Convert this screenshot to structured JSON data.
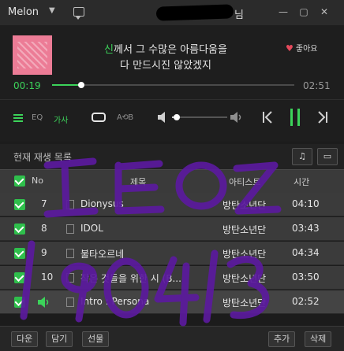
{
  "app": {
    "name": "Melon",
    "username_suffix": "님"
  },
  "window_controls": [
    "—",
    "▢",
    "✕"
  ],
  "player": {
    "lyrics": {
      "line1_highlight": "신",
      "line1_rest": "께서 그 수많은 아름다움을",
      "line2": "다 만드시진 않았겠지"
    },
    "like_label": "좋아요",
    "current_time": "00:19",
    "total_time": "02:51",
    "progress": 0.12,
    "volume": 0.08,
    "eq_label": "EQ",
    "lyrics_label": "가사",
    "shuffle_label": "A⟲B"
  },
  "playlist": {
    "title": "현재 재생 목록",
    "columns": {
      "no": "No",
      "title": "제목",
      "artist": "아티스트",
      "time": "시간"
    },
    "rows": [
      {
        "no": "7",
        "title": "Dionysus",
        "artist": "방탄소년단",
        "time": "04:10"
      },
      {
        "no": "8",
        "title": "IDOL",
        "artist": "방탄소년단",
        "time": "03:43"
      },
      {
        "no": "9",
        "title": "불타오르네",
        "artist": "방탄소년단",
        "time": "04:34"
      },
      {
        "no": "10",
        "title": "작은 것들을 위한 시 (B...",
        "artist": "방탄소년단",
        "time": "03:50"
      },
      {
        "no": "",
        "title": "Intro : Persona",
        "artist": "방탄소년단",
        "time": "02:52"
      }
    ]
  },
  "footer": {
    "listen": "다운",
    "save": "담기",
    "gift": "선물",
    "add": "추가",
    "delete": "삭제"
  },
  "handwriting": {
    "line1": "IEOZ",
    "line2": "190413"
  }
}
